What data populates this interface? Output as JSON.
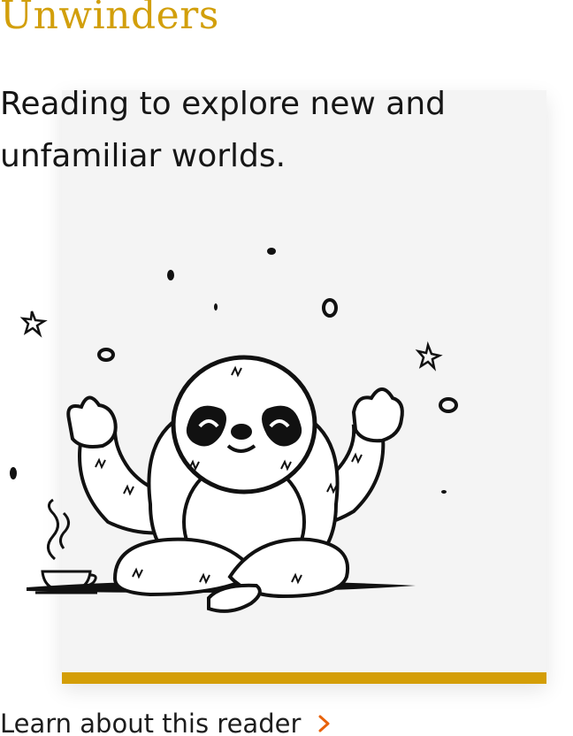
{
  "header": {
    "title": "Unwinders"
  },
  "card": {
    "tagline": "Reading to explore new and unfamiliar worlds.",
    "accent_color": "#d49e06",
    "background_color": "#f4f4f4"
  },
  "illustration": {
    "subject": "meditating-sloth-with-tea-cup"
  },
  "footer": {
    "link_label": "Learn about this reader",
    "link_icon": "chevron-right-icon",
    "link_icon_color": "#e8620a"
  },
  "colors": {
    "brand_gold": "#d29f0b",
    "text": "#1d1d1d"
  }
}
